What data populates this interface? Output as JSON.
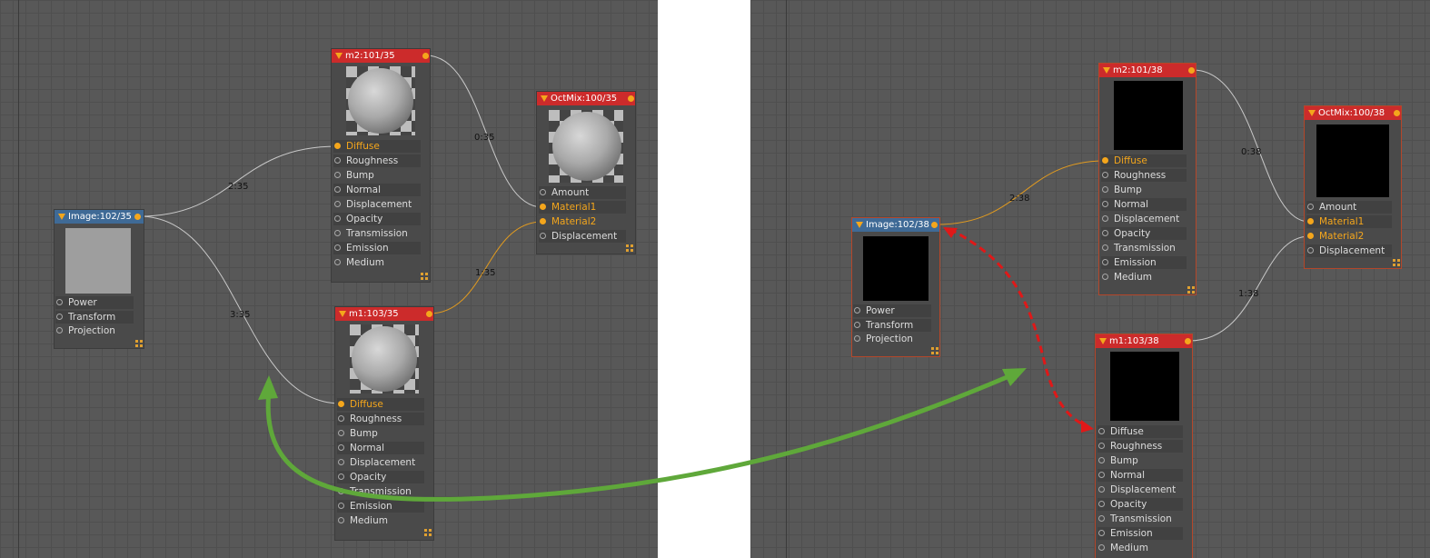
{
  "left": {
    "nodes": {
      "image": {
        "title": "Image:102/35",
        "ports": [
          "Power",
          "Transform",
          "Projection"
        ]
      },
      "m2": {
        "title": "m2:101/35",
        "ports": [
          "Diffuse",
          "Roughness",
          "Bump",
          "Normal",
          "Displacement",
          "Opacity",
          "Transmission",
          "Emission",
          "Medium"
        ]
      },
      "m1": {
        "title": "m1:103/35",
        "ports": [
          "Diffuse",
          "Roughness",
          "Bump",
          "Normal",
          "Displacement",
          "Opacity",
          "Transmission",
          "Emission",
          "Medium"
        ]
      },
      "mix": {
        "title": "OctMix:100/35",
        "ports": [
          "Amount",
          "Material1",
          "Material2",
          "Displacement"
        ]
      }
    },
    "edges": [
      "2:35",
      "3:35",
      "0:35",
      "1:35"
    ]
  },
  "right": {
    "nodes": {
      "image": {
        "title": "Image:102/38",
        "ports": [
          "Power",
          "Transform",
          "Projection"
        ]
      },
      "m2": {
        "title": "m2:101/38",
        "ports": [
          "Diffuse",
          "Roughness",
          "Bump",
          "Normal",
          "Displacement",
          "Opacity",
          "Transmission",
          "Emission",
          "Medium"
        ]
      },
      "m1": {
        "title": "m1:103/38",
        "ports": [
          "Diffuse",
          "Roughness",
          "Bump",
          "Normal",
          "Displacement",
          "Opacity",
          "Transmission",
          "Emission",
          "Medium"
        ]
      },
      "mix": {
        "title": "OctMix:100/38",
        "ports": [
          "Amount",
          "Material1",
          "Material2",
          "Displacement"
        ]
      }
    },
    "edges": [
      "2:38",
      "0:38",
      "1:38"
    ]
  },
  "colors": {
    "node_header_red": "#cc2b2b",
    "node_header_blue": "#3f6a96",
    "port_active": "#f4a61c",
    "annotation_green": "#5fa83a",
    "annotation_red": "#e01818"
  }
}
